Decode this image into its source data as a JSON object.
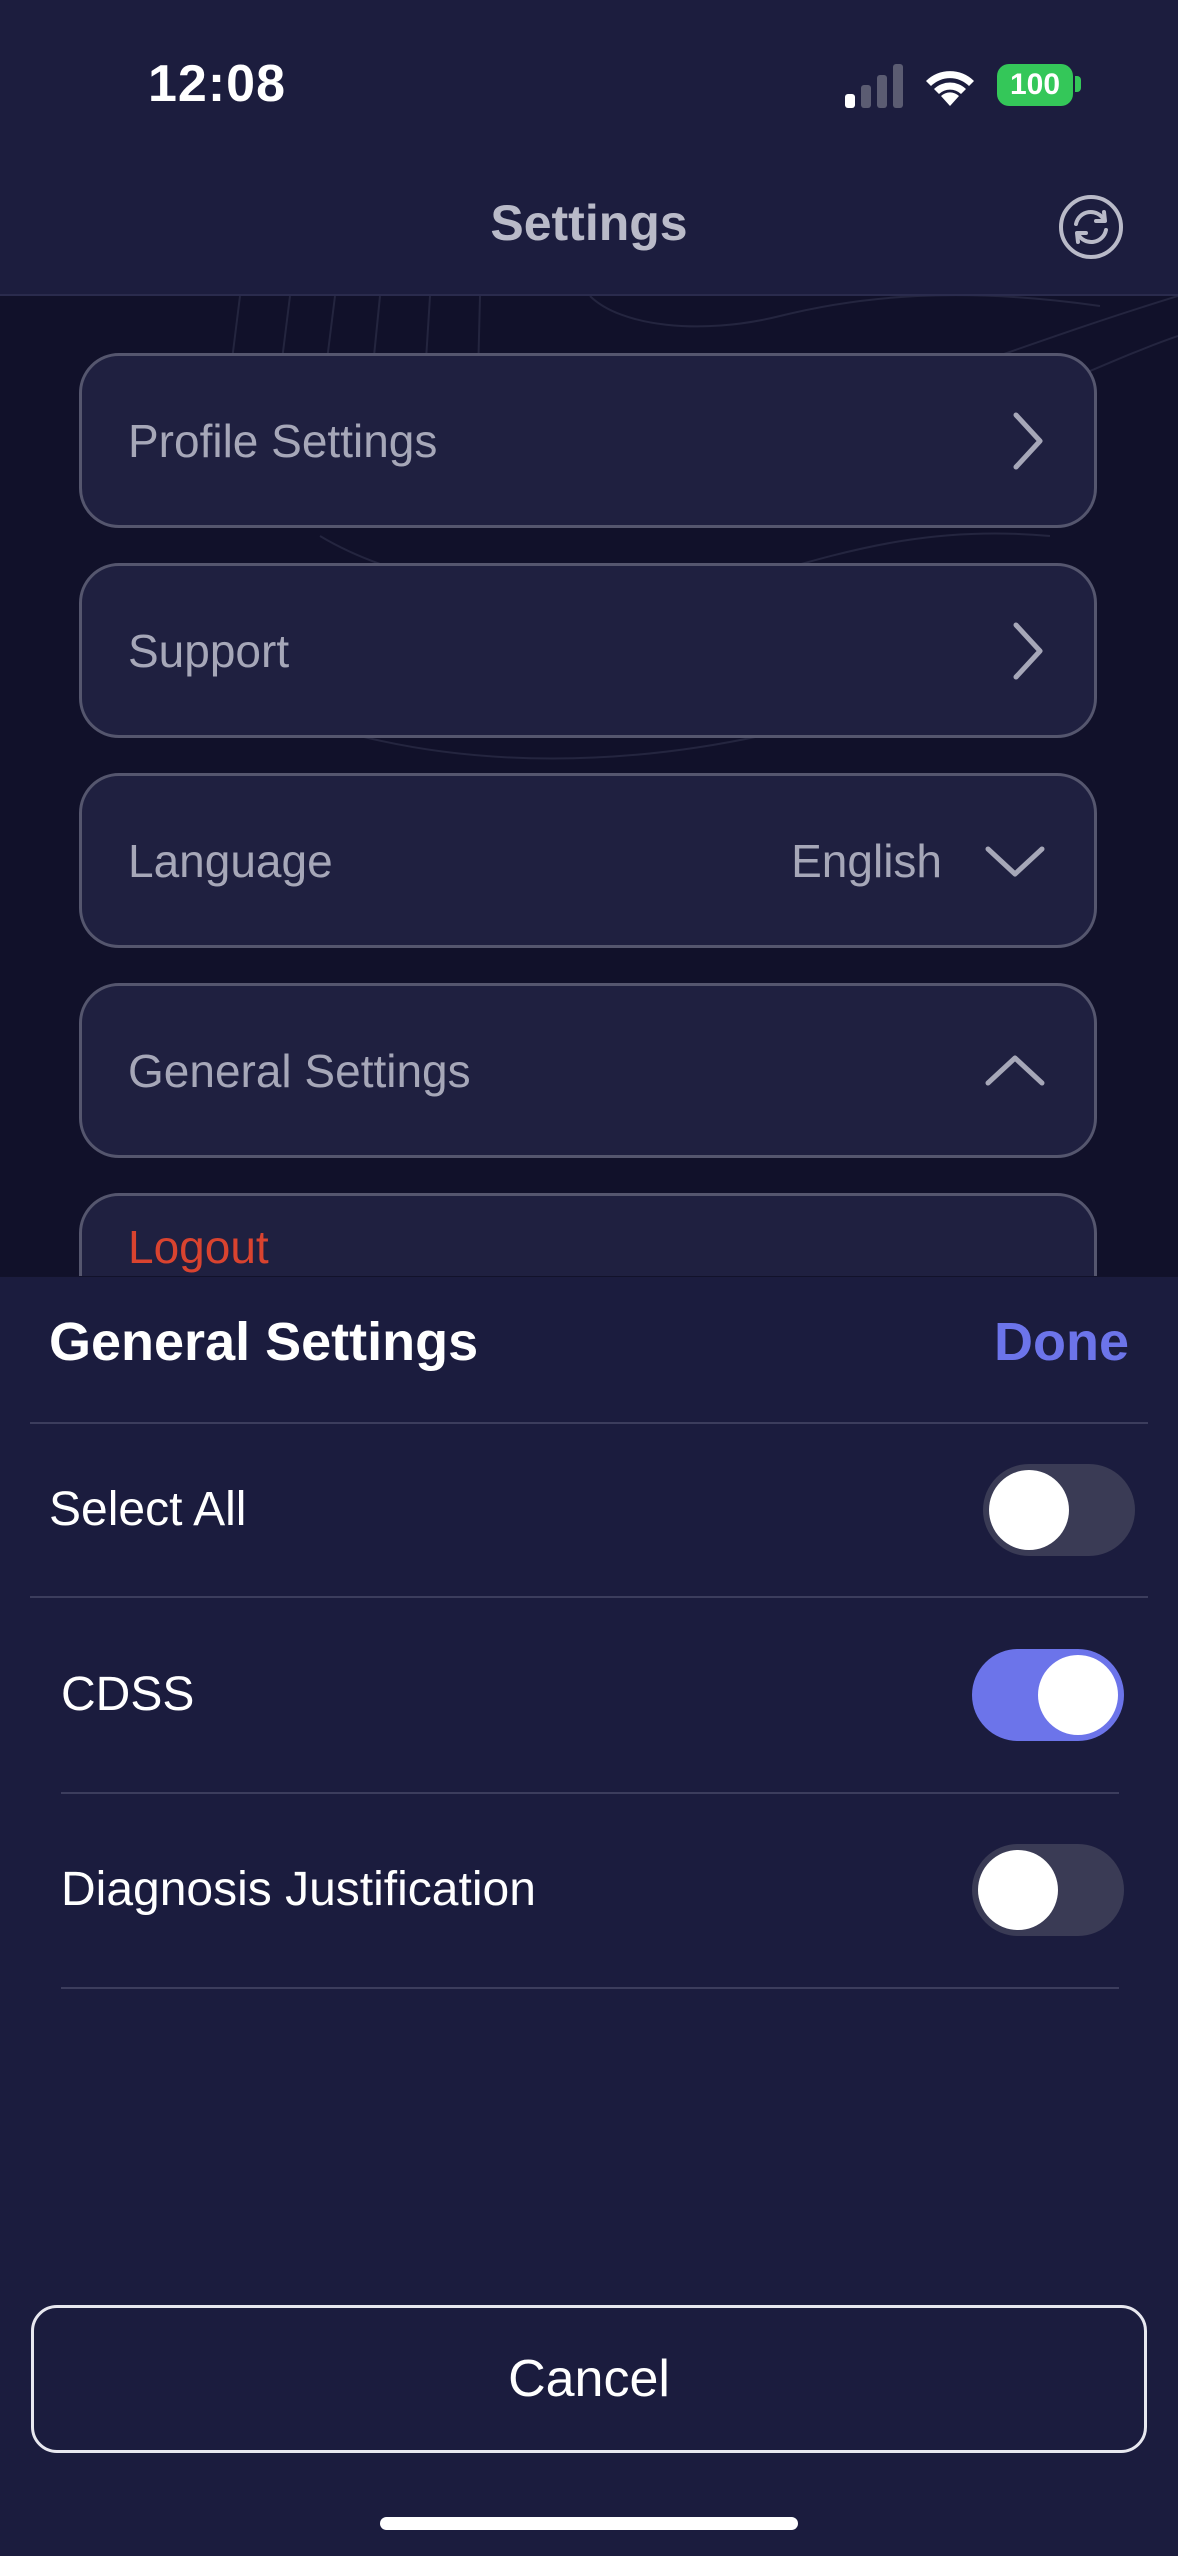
{
  "status_bar": {
    "time": "12:08",
    "battery": "100",
    "icons": [
      "cellular-signal-icon",
      "wifi-icon",
      "battery-icon"
    ]
  },
  "nav": {
    "title": "Settings",
    "refresh_icon": "refresh-icon"
  },
  "settings_list": {
    "profile": {
      "label": "Profile Settings",
      "icon": "chevron-right-icon"
    },
    "support": {
      "label": "Support",
      "icon": "chevron-right-icon"
    },
    "language": {
      "label": "Language",
      "value": "English",
      "icon": "chevron-down-icon"
    },
    "general": {
      "label": "General Settings",
      "icon": "chevron-up-icon"
    },
    "logout": {
      "label": "Logout"
    }
  },
  "sheet": {
    "title": "General Settings",
    "done_label": "Done",
    "select_all": {
      "label": "Select All",
      "on": false
    },
    "options": [
      {
        "label": "CDSS",
        "on": true
      },
      {
        "label": "Diagnosis Justification",
        "on": false
      }
    ],
    "cancel_label": "Cancel"
  },
  "colors": {
    "accent": "#6c74ea",
    "sheet_background": "#1b1c3e",
    "logout": "#d9432f",
    "battery": "#34c759"
  }
}
